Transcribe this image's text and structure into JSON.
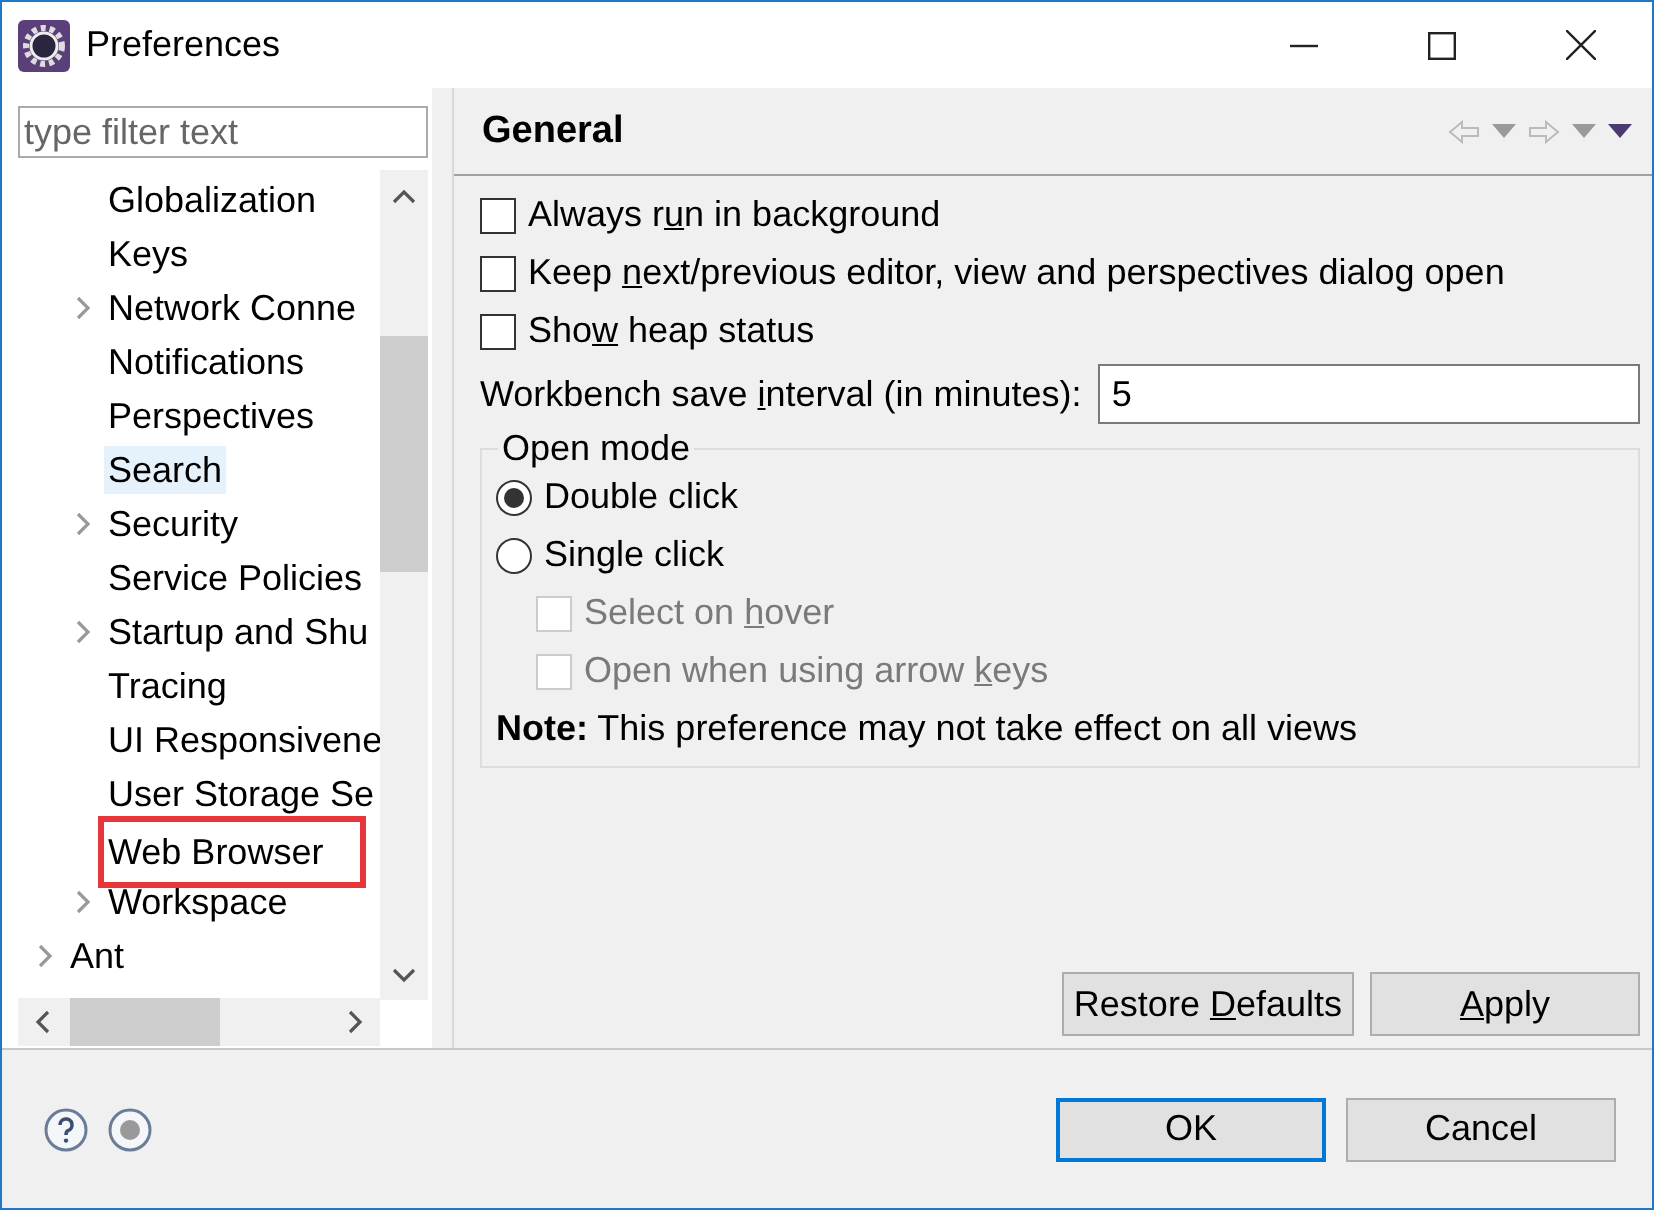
{
  "window": {
    "title": "Preferences"
  },
  "filter": {
    "placeholder": "type filter text"
  },
  "tree": [
    {
      "children": [
        {
          "label": "Globalization",
          "selected": false,
          "highlighted": false
        },
        {
          "label": "Keys",
          "selected": false,
          "highlighted": false
        },
        {
          "label": "Network Conne",
          "expandable": true,
          "selected": false,
          "highlighted": false
        },
        {
          "label": "Notifications",
          "selected": false,
          "highlighted": false
        },
        {
          "label": "Perspectives",
          "selected": false,
          "highlighted": false
        },
        {
          "label": "Search",
          "selected": true,
          "highlighted": false
        },
        {
          "label": "Security",
          "expandable": true,
          "selected": false,
          "highlighted": false
        },
        {
          "label": "Service Policies",
          "selected": false,
          "highlighted": false
        },
        {
          "label": "Startup and Shu",
          "expandable": true,
          "selected": false,
          "highlighted": false
        },
        {
          "label": "Tracing",
          "selected": false,
          "highlighted": false
        },
        {
          "label": "UI Responsivene",
          "selected": false,
          "highlighted": false
        },
        {
          "label": "User Storage Se",
          "selected": false,
          "highlighted": false
        },
        {
          "label": "Web Browser",
          "selected": false,
          "highlighted": true
        },
        {
          "label": "Workspace",
          "expandable": true,
          "selected": false,
          "highlighted": false
        }
      ]
    },
    {
      "label": "Ant",
      "expandable": true,
      "selected": false,
      "highlighted": false
    }
  ],
  "page": {
    "title": "General",
    "options": [
      {
        "label": {
          "before": "Always r",
          "key": "u",
          "after": "n in background"
        },
        "checked": false
      },
      {
        "label": {
          "before": "Keep ",
          "key": "n",
          "after": "ext/previous editor, view and perspectives dialog open"
        },
        "checked": false
      },
      {
        "label": {
          "before": "Sho",
          "key": "w",
          "after": " heap status"
        },
        "checked": false
      }
    ],
    "save_interval": {
      "label": {
        "before": "Workbench save ",
        "key": "i",
        "after": "nterval (in minutes):"
      },
      "value": "5"
    },
    "open_mode": {
      "title": "Open mode",
      "modes": [
        {
          "label": "Double click",
          "selected": true
        },
        {
          "label": "Single click",
          "selected": false
        }
      ],
      "suboptions": [
        {
          "label": {
            "before": "Select on ",
            "key": "h",
            "after": "over"
          },
          "checked": false,
          "disabled": true
        },
        {
          "label": {
            "before": "Open when using arrow ",
            "key": "k",
            "after": "eys"
          },
          "checked": false,
          "disabled": true
        }
      ],
      "note": "**Note:** This preference may not take effect on all views"
    },
    "buttons": [
      {
        "before": "Restore ",
        "key": "D",
        "after": "efaults"
      },
      {
        "key": "A",
        "after": "pply"
      }
    ]
  },
  "footer_buttons": [
    {
      "label": "OK",
      "default": true
    },
    {
      "label": "Cancel",
      "default": false
    }
  ]
}
